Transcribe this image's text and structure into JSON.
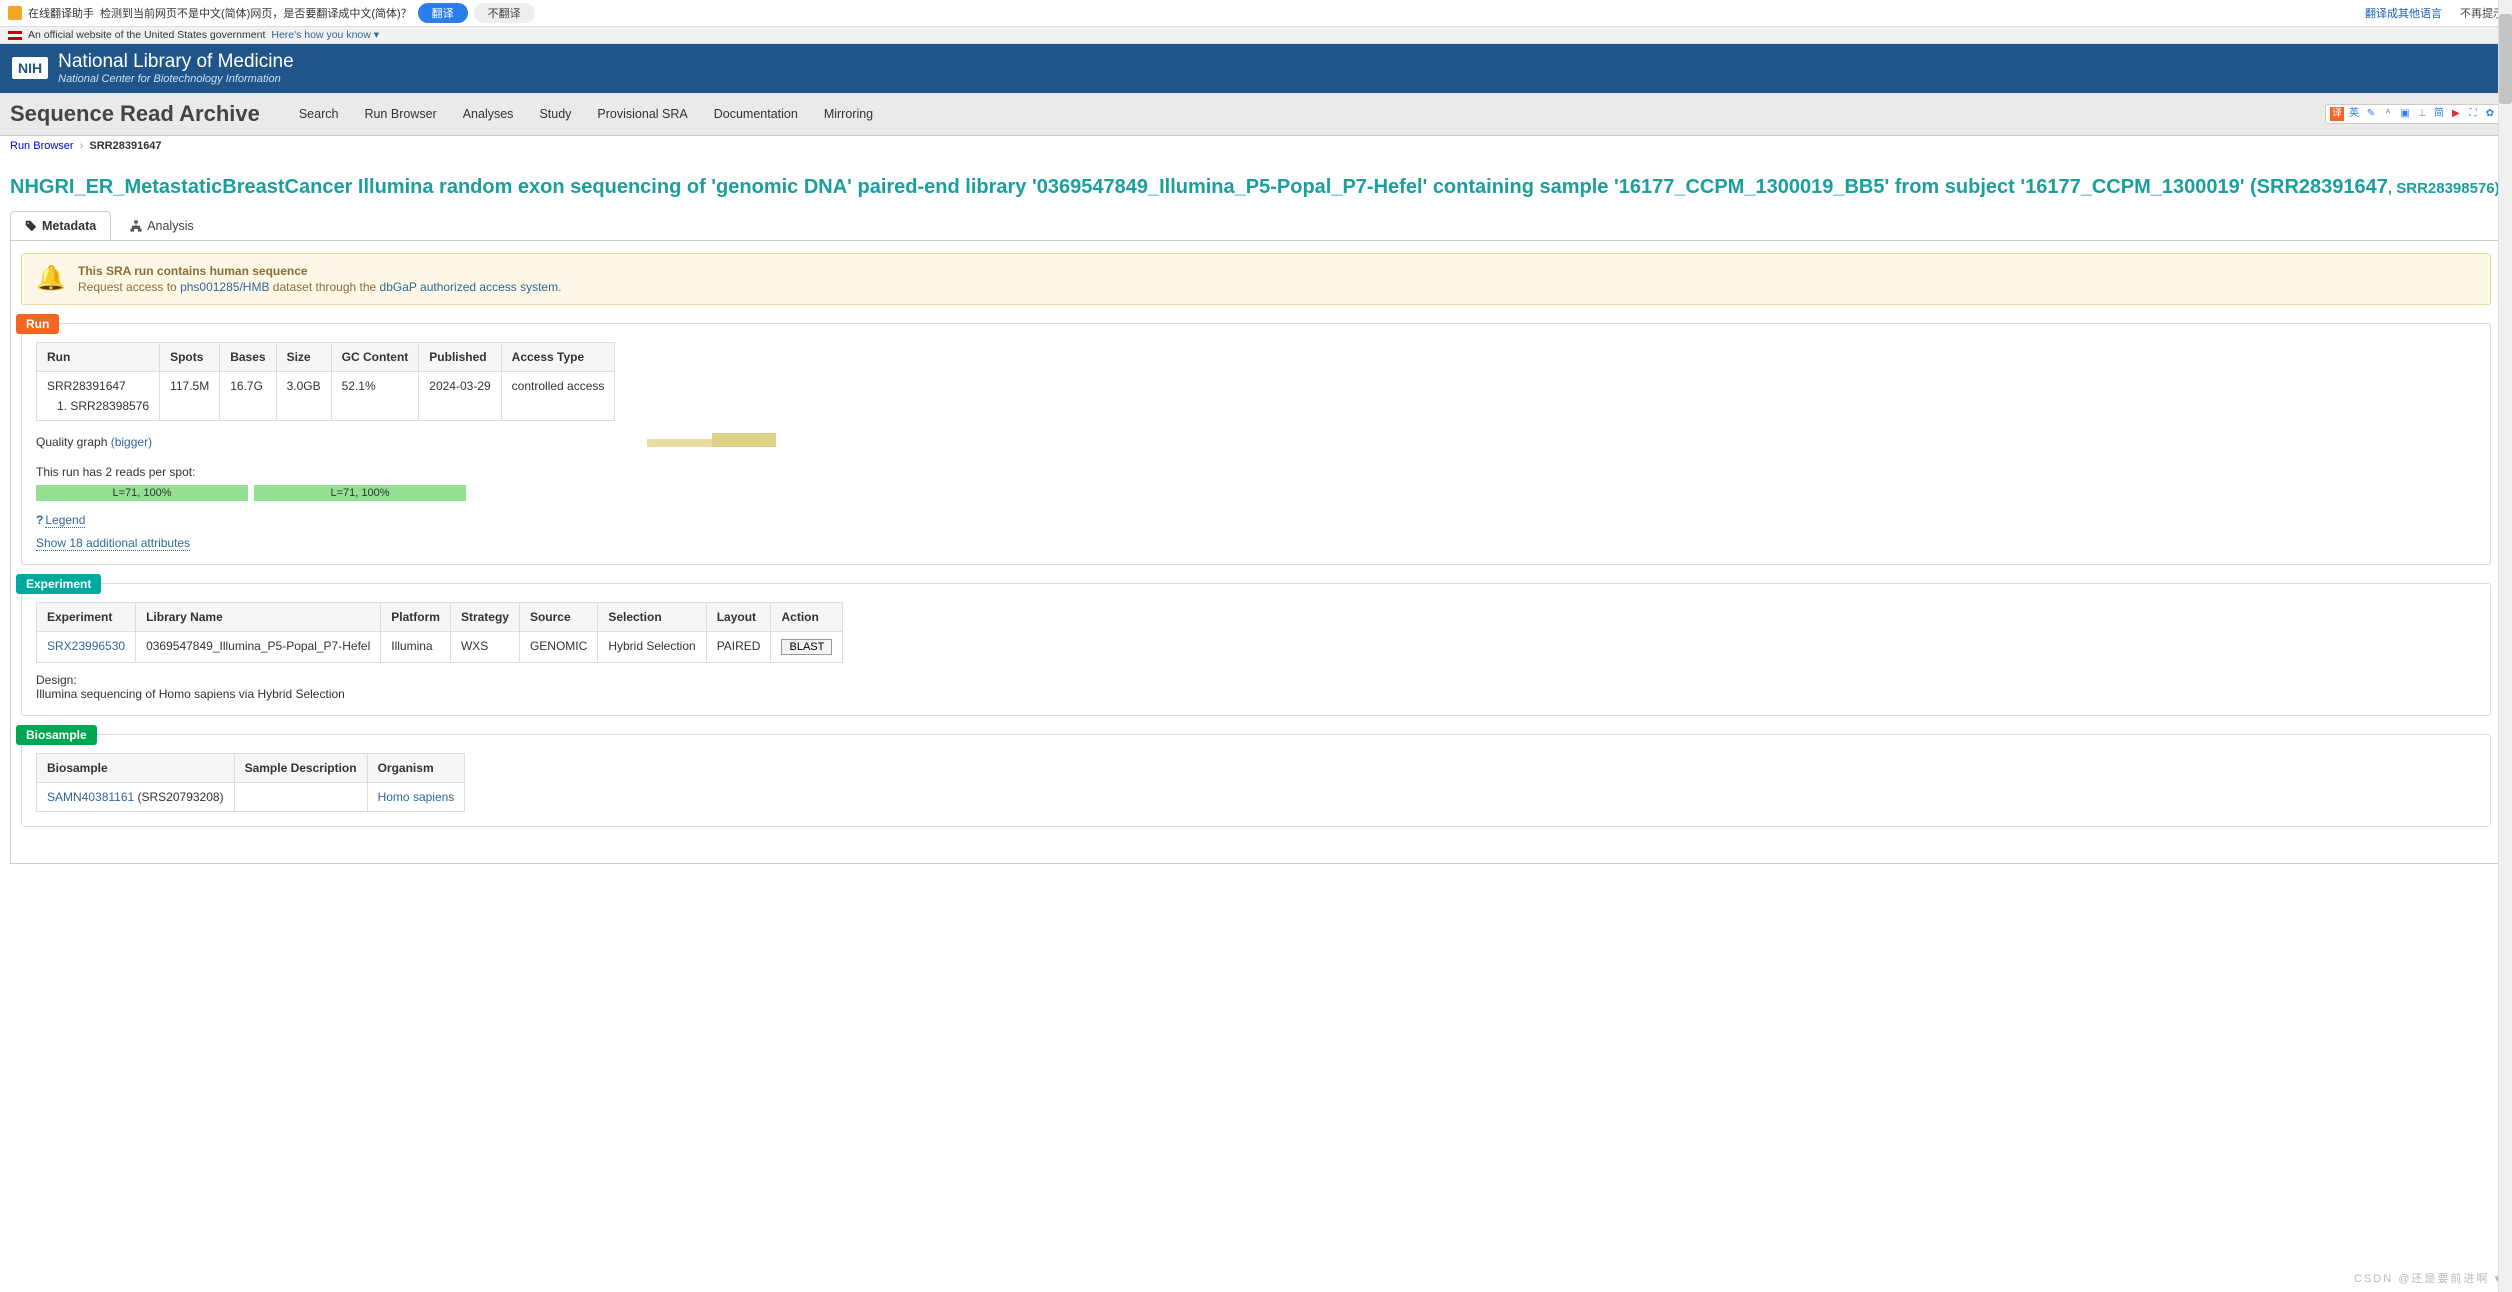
{
  "translate_bar": {
    "assistant": "在线翻译助手",
    "detect": "检测到当前网页不是中文(简体)网页，是否要翻译成中文(简体)？",
    "translate_btn": "翻译",
    "no_translate_btn": "不翻译",
    "other_lang": "翻译成其他语言",
    "no_suggest": "不再提示"
  },
  "gov_banner": {
    "text": "An official website of the United States government",
    "know": "Here's how you know ▾"
  },
  "nih": {
    "logo": "NIH",
    "title": "National Library of Medicine",
    "subtitle": "National Center for Biotechnology Information"
  },
  "sra": {
    "heading": "Sequence Read Archive",
    "nav": [
      "Search",
      "Run Browser",
      "Analyses",
      "Study",
      "Provisional SRA",
      "Documentation",
      "Mirroring"
    ],
    "tool_labels": [
      "译",
      "英",
      "✎",
      "ᴬ",
      "▣",
      "⊥",
      "简",
      "▶",
      "⛶",
      "✿"
    ]
  },
  "crumbs": {
    "a": "Run Browser",
    "b": "SRR28391647"
  },
  "page_title_main": "NHGRI_ER_MetastaticBreastCancer Illumina random exon sequencing of 'genomic DNA' paired-end library '0369547849_Illumina_P5-Popal_P7-Hefel' containing sample '16177_CCPM_1300019_BB5' from subject '16177_CCPM_1300019' (SRR28391647",
  "page_title_tail": ", SRR28398576)",
  "tabs": {
    "metadata": "Metadata",
    "analysis": "Analysis"
  },
  "alert": {
    "title": "This SRA run contains human sequence",
    "lead": "Request access to ",
    "dataset": "phs001285/HMB",
    "mid": " dataset through the ",
    "system": "dbGaP authorized access system",
    "tail": "."
  },
  "run_section": {
    "badge": "Run",
    "headers": [
      "Run",
      "Spots",
      "Bases",
      "Size",
      "GC Content",
      "Published",
      "Access Type"
    ],
    "row": {
      "run": "SRR28391647",
      "spots": "117.5M",
      "bases": "16.7G",
      "size": "3.0GB",
      "gc": "52.1%",
      "published": "2024-03-29",
      "access": "controlled access",
      "subrun": "SRR28398576"
    },
    "quality_label": "Quality graph ",
    "bigger": "(bigger)",
    "reads_label": "This run has 2 reads per spot:",
    "read1": "L=71, 100%",
    "read2": "L=71, 100%",
    "legend": "Legend",
    "show_more": "Show 18 additional attributes"
  },
  "experiment_section": {
    "badge": "Experiment",
    "headers": [
      "Experiment",
      "Library Name",
      "Platform",
      "Strategy",
      "Source",
      "Selection",
      "Layout",
      "Action"
    ],
    "row": {
      "exp": "SRX23996530",
      "lib": "0369547849_Illumina_P5-Popal_P7-Hefel",
      "platform": "Illumina",
      "strategy": "WXS",
      "source": "GENOMIC",
      "selection": "Hybrid Selection",
      "layout": "PAIRED",
      "action": "BLAST"
    },
    "design_label": "Design:",
    "design_text": "Illumina sequencing of Homo sapiens via Hybrid Selection"
  },
  "biosample_section": {
    "badge": "Biosample",
    "headers": [
      "Biosample",
      "Sample Description",
      "Organism"
    ],
    "row": {
      "bio": "SAMN40381161",
      "srs": " (SRS20793208)",
      "desc": "",
      "organism": "Homo sapiens"
    }
  },
  "watermark": "CSDN @还是要前进啊 ▾"
}
